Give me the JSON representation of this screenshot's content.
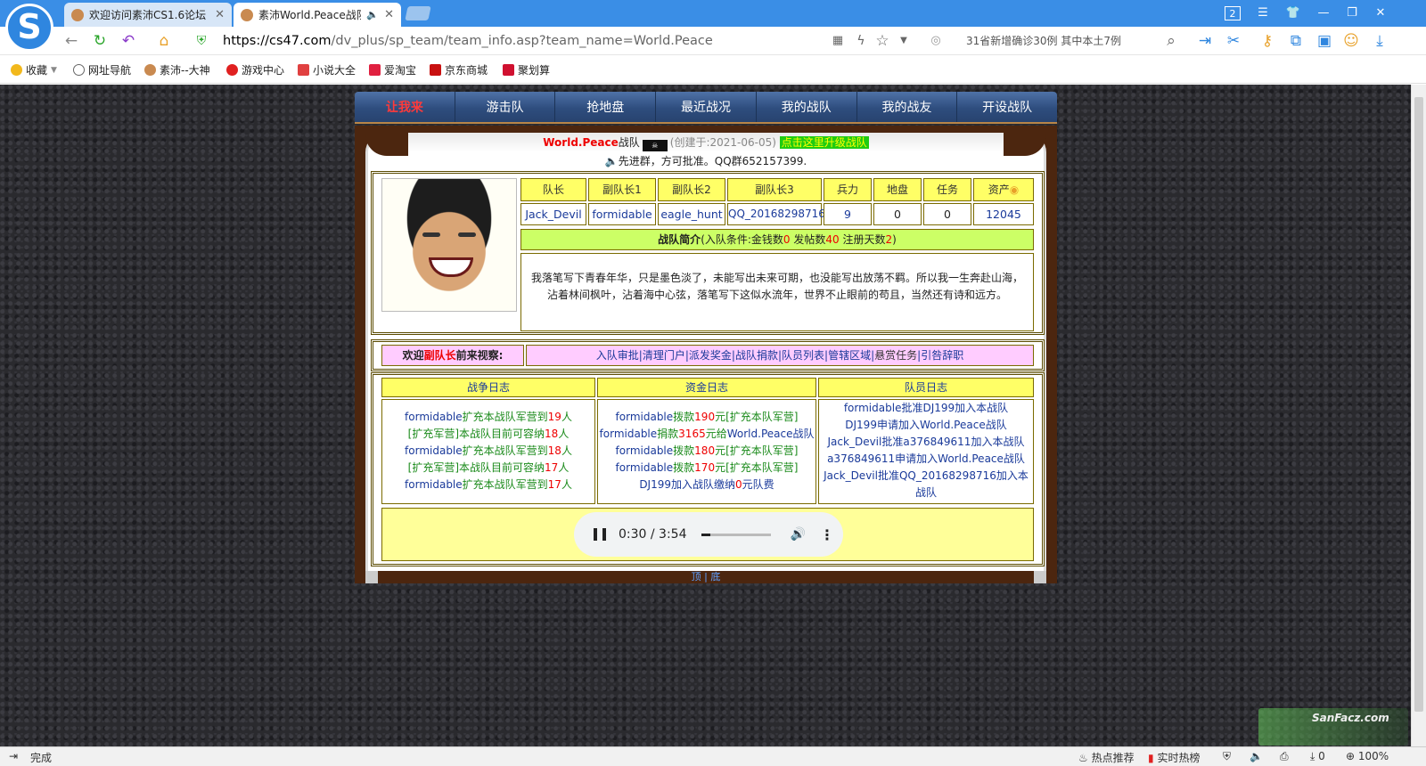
{
  "browser": {
    "tabs": [
      {
        "label": "欢迎访问素沛CS1.6论坛"
      },
      {
        "label": "素沛World.Peace战队"
      }
    ],
    "url_host": "https://cs47.com",
    "url_path": "/dv_plus/sp_team/team_info.asp?team_name=World.Peace",
    "search_hint": "31省新增确诊30例 其中本土7例",
    "bookmarks": [
      "收藏",
      "网址导航",
      "素沛--大神",
      "游戏中心",
      "小说大全",
      "爱淘宝",
      "京东商城",
      "聚划算"
    ],
    "status_left": "完成",
    "status_right": [
      "热点推荐",
      "实时热榜",
      "0",
      "100%"
    ],
    "window_badge": "2"
  },
  "page": {
    "menu": [
      "让我来",
      "游击队",
      "抢地盘",
      "最近战况",
      "我的战队",
      "我的战友",
      "开设战队"
    ],
    "title": {
      "name": "World.Peace",
      "suffix": "战队",
      "created": "(创建于:2021-06-05)",
      "upgrade": "点击这里升级战队"
    },
    "notice": "先进群，方可批准。QQ群652157399.",
    "headers": [
      "队长",
      "副队长1",
      "副队长2",
      "副队长3",
      "兵力",
      "地盘",
      "任务",
      "资产"
    ],
    "values": [
      "Jack_Devil",
      "formidable",
      "eagle_hunt",
      "QQ_20168298716",
      "9",
      "0",
      "0",
      "12045"
    ],
    "intro_header": {
      "label": "战队简介",
      "p1": "(入队条件:金钱数",
      "v1": "0",
      "p2": " 发帖数",
      "v2": "40",
      "p3": " 注册天数",
      "v3": "2",
      "p4": ")"
    },
    "intro_text": "我落笔写下青春年华，只是墨色淡了，未能写出未来可期，也没能写出放荡不羁。所以我一生奔赴山海，沾着林间枫叶，沾着海中心弦，落笔写下这似水流年，世界不止眼前的苟且，当然还有诗和远方。",
    "welcome": {
      "prefix": "欢迎",
      "role": "副队长",
      "suffix": "前来视察:"
    },
    "actions": [
      "入队审批",
      "清理门户",
      "派发奖金",
      "战队捐款",
      "队员列表",
      "管辖区域",
      "悬赏任务",
      "引咎辞职"
    ],
    "logs": {
      "war_title": "战争日志",
      "fund_title": "资金日志",
      "member_title": "队员日志",
      "war": [
        [
          "formidable",
          "扩充本战队军营到",
          "19",
          "人"
        ],
        [
          "[",
          "扩充军营",
          "]本战队目前可容纳",
          "18",
          "人"
        ],
        [
          "formidable",
          "扩充本战队军营到",
          "18",
          "人"
        ],
        [
          "[",
          "扩充军营",
          "]本战队目前可容纳",
          "17",
          "人"
        ],
        [
          "formidable",
          "扩充本战队军营到",
          "17",
          "人"
        ]
      ],
      "fund": [
        [
          "formidable",
          "拨款",
          "190",
          "元[",
          "扩充本队军营",
          "]"
        ],
        [
          "formidable",
          "捐款",
          "3165",
          "元给",
          "World.Peace战队"
        ],
        [
          "formidable",
          "拨款",
          "180",
          "元[",
          "扩充本队军营",
          "]"
        ],
        [
          "formidable",
          "拨款",
          "170",
          "元[",
          "扩充本队军营",
          "]"
        ],
        [
          "DJ199",
          "加入战队缴纳",
          "0",
          "元",
          "队费"
        ]
      ],
      "member": [
        [
          "formidable",
          "批准",
          "DJ199",
          "加入本战队"
        ],
        [
          "DJ199",
          "申请加入",
          "World.Peace",
          "战队"
        ],
        [
          "Jack_Devil",
          "批准",
          "a376849611",
          "加入本战队"
        ],
        [
          "a376849611",
          "申请加入",
          "World.Peace",
          "战队"
        ],
        [
          "Jack_Devil",
          "批准",
          "QQ_20168298716",
          "加入本战队"
        ]
      ]
    },
    "audio": {
      "time": "0:30 / 3:54",
      "progress": 0.13
    },
    "footer": [
      "顶",
      "底"
    ],
    "watermark": "SanFacz.com"
  },
  "colors": {
    "browser_blue": "#3a8ee6",
    "menu_blue": "#2e4d7e",
    "panel_brown": "#4c260f",
    "cell_yellow": "#ffff66",
    "intro_green": "#ccff66",
    "welcome_pink": "#ffccff",
    "link_blue": "#1a3a9a",
    "accent_red": "#e00000"
  }
}
